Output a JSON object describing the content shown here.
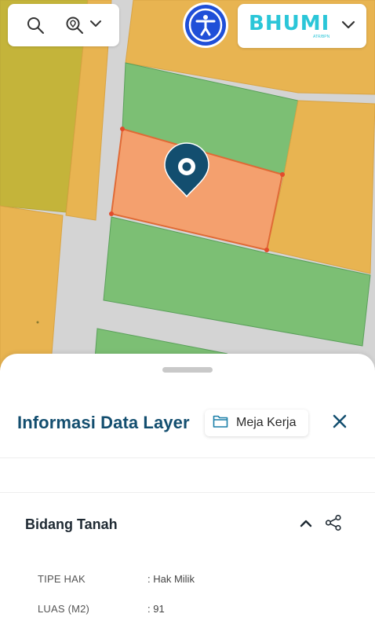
{
  "toolbar": {
    "search_icon": "search-icon",
    "zoom_icon": "zoom-location-icon",
    "zoom_chevron": "chevron-down-icon",
    "accessibility_icon": "accessibility-icon"
  },
  "brand": {
    "name": "BHUMI",
    "tagline": "ATR/BPN",
    "chevron": "chevron-down-icon",
    "color": "#2bc6d8"
  },
  "map": {
    "marker_color": "#134e6f",
    "selected_parcel_color": "#f4a06e",
    "parcel_green": "#7cbf74",
    "parcel_orange": "#e8b451",
    "parcel_olive": "#c4b43a"
  },
  "panel": {
    "title": "Informasi Data Layer",
    "workspace_label": "Meja Kerja",
    "workspace_icon": "folder-icon",
    "close_icon": "close-icon"
  },
  "section": {
    "title": "Bidang Tanah",
    "collapse_icon": "chevron-up-icon",
    "share_icon": "share-icon",
    "attributes": [
      {
        "key": "TIPE HAK",
        "value": ": Hak Milik"
      },
      {
        "key": "LUAS (M2)",
        "value": ": 91"
      }
    ]
  }
}
